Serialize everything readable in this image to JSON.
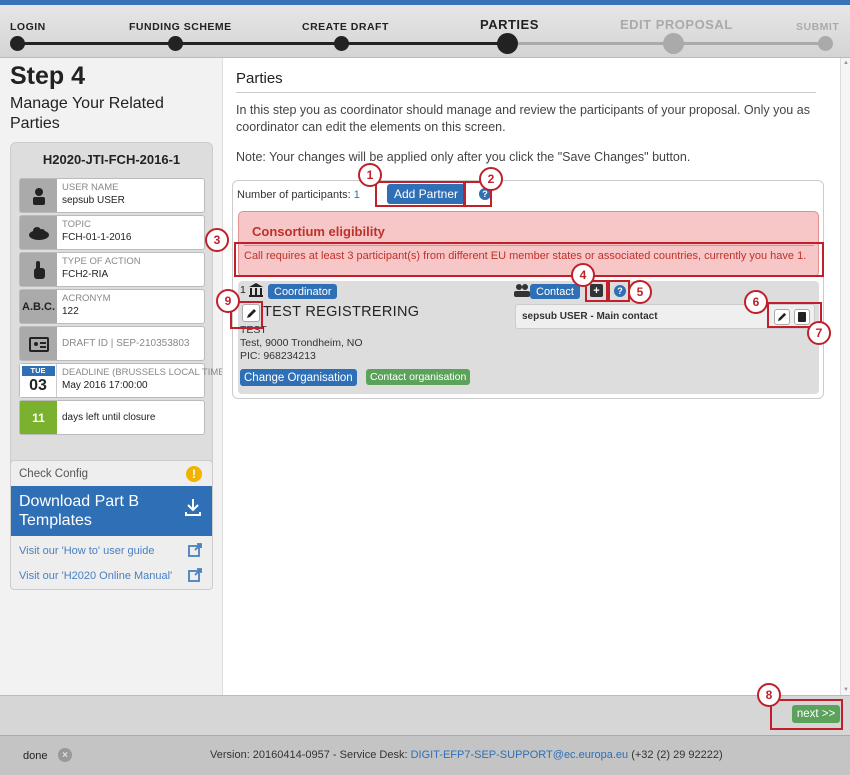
{
  "steps": [
    {
      "label": "LOGIN",
      "state": "done"
    },
    {
      "label": "FUNDING SCHEME",
      "state": "done"
    },
    {
      "label": "CREATE DRAFT",
      "state": "done"
    },
    {
      "label": "PARTIES",
      "state": "current"
    },
    {
      "label": "EDIT PROPOSAL",
      "state": "todo"
    },
    {
      "label": "SUBMIT",
      "state": "todo"
    }
  ],
  "sidebar": {
    "step_title": "Step 4",
    "step_subtitle": "Manage Your Related Parties",
    "call_id": "H2020-JTI-FCH-2016-1",
    "user_name_label": "USER NAME",
    "user_name": "sepsub USER",
    "topic_label": "TOPIC",
    "topic": "FCH-01-1-2016",
    "action_label": "TYPE OF ACTION",
    "action": "FCH2-RIA",
    "acronym_icon": "A.B.C.",
    "acronym_label": "ACRONYM",
    "acronym": "122",
    "draft_label": "DRAFT ID | SEP-210353803",
    "deadline_label": "DEADLINE (Brussels Local Time)",
    "deadline": "May 2016 17:00:00",
    "cal_day": "TUE",
    "cal_date": "03",
    "days_left": "11",
    "days_left_text": "days left until closure",
    "check_config": "Check Config",
    "download_label": "Download Part B Templates",
    "link_howto": "Visit our 'How to' user guide",
    "link_manual": "Visit our 'H2020 Online Manual'"
  },
  "main": {
    "title": "Parties",
    "intro": "In this step you as coordinator should manage and review the participants of your proposal. Only you as coordinator can edit the elements on this screen.",
    "note": "Note: Your changes will be applied only after you click the \"Save Changes\" button.",
    "num_participants_label": "Number of participants:",
    "num_participants": "1",
    "add_partner": "Add Partner",
    "help_glyph": "?",
    "eligibility_title": "Consortium eligibility",
    "eligibility_msg": "Call requires at least 3 participant(s) from different EU member states or associated countries, currently you have 1.",
    "partner": {
      "number": "1",
      "role": "Coordinator",
      "contact_tag": "Contact",
      "name": "TEST REGISTRERING",
      "short_name": "TEST",
      "address": "Test, 9000 Trondheim, NO",
      "pic": "PIC: 968234213",
      "change_btn": "Change Organisation",
      "contact_btn": "Contact organisation",
      "main_contact": "sepsub USER - Main contact"
    }
  },
  "annotations": [
    "1",
    "2",
    "3",
    "4",
    "5",
    "6",
    "7",
    "8",
    "9"
  ],
  "next_label": "next >>",
  "footer": {
    "done": "done",
    "version": "Version: 20160414-0957 - Service Desk: ",
    "email": "DIGIT-EFP7-SEP-SUPPORT@ec.europa.eu",
    "phone": " (+32 (2) 29 92222)"
  },
  "colors": {
    "accent": "#2e6fb5",
    "success": "#5ba35b",
    "error": "#c0302a",
    "annotation": "#c0202a"
  }
}
